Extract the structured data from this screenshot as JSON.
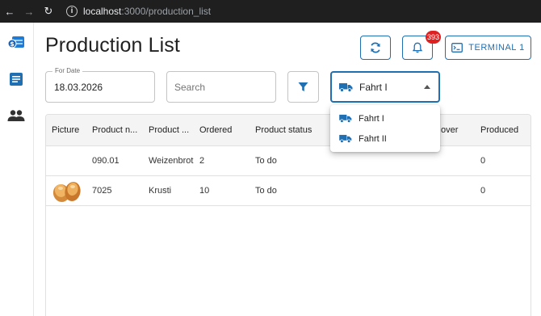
{
  "browser": {
    "url_host": "localhost",
    "url_path": ":3000/production_list",
    "back_glyph": "←",
    "forward_glyph": "→",
    "reload_glyph": "↻",
    "info_glyph": "i"
  },
  "sidebar": {
    "items": [
      {
        "name": "app-logo-icon"
      },
      {
        "name": "list-document-icon"
      },
      {
        "name": "people-icon"
      }
    ]
  },
  "header": {
    "title": "Production List",
    "notification_count": "393",
    "terminal_label": "TERMINAL 1"
  },
  "filters": {
    "date_label": "For Date",
    "date_value": "18.03.2026",
    "search_placeholder": "Search",
    "selected_route": "Fahrt I"
  },
  "dropdown": {
    "options": [
      "Fahrt I",
      "Fahrt II"
    ]
  },
  "table": {
    "columns": [
      "Picture",
      "Product n...",
      "Product ...",
      "Ordered",
      "Product status",
      "over",
      "Produced"
    ],
    "rows": [
      {
        "number": "090.01",
        "name": "Weizenbrot",
        "ordered": "2",
        "status": "To do",
        "produced": "0"
      },
      {
        "number": "7025",
        "name": "Krusti",
        "ordered": "10",
        "status": "To do",
        "produced": "0"
      }
    ]
  },
  "colors": {
    "accent": "#1f6fb2",
    "badge": "#e02020",
    "browser_bar": "#1f1f1f"
  }
}
